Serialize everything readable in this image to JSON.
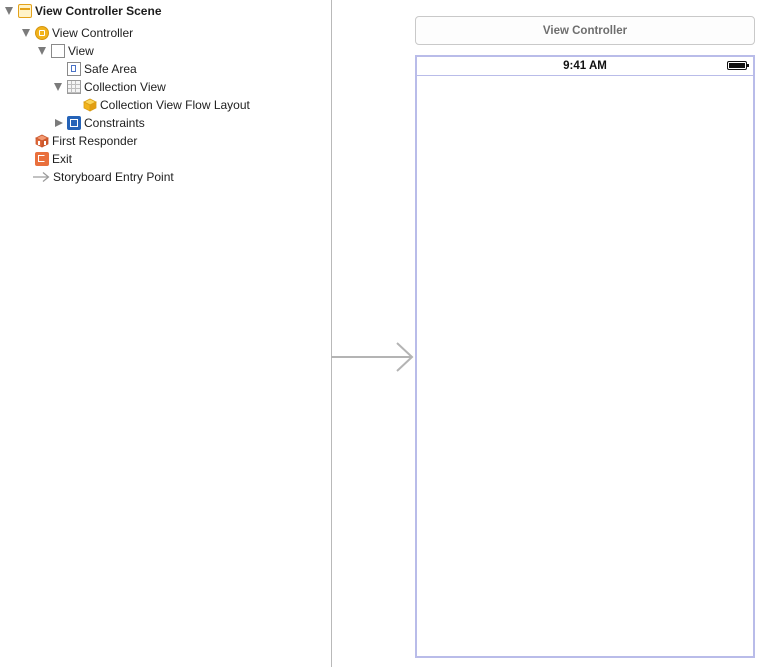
{
  "outline": {
    "scene": {
      "label": "View Controller Scene",
      "icon": "scene-icon"
    },
    "view_controller": {
      "label": "View Controller",
      "icon": "view-controller-icon"
    },
    "view": {
      "label": "View",
      "icon": "view-icon"
    },
    "safe_area": {
      "label": "Safe Area",
      "icon": "safe-area-icon"
    },
    "collection_view": {
      "label": "Collection View",
      "icon": "collection-view-icon"
    },
    "flow_layout": {
      "label": "Collection View Flow Layout",
      "icon": "cube-icon"
    },
    "constraints": {
      "label": "Constraints",
      "icon": "constraints-icon"
    },
    "first_responder": {
      "label": "First Responder",
      "icon": "first-responder-icon"
    },
    "exit": {
      "label": "Exit",
      "icon": "exit-icon"
    },
    "entry_point": {
      "label": "Storyboard Entry Point",
      "icon": "arrow-right-icon"
    }
  },
  "canvas": {
    "scene_title": "View Controller",
    "status_time": "9:41 AM",
    "battery_icon": "battery-icon"
  },
  "colors": {
    "scene_accent": "#e4a21a",
    "view_controller": "#f2b31b",
    "constraints": "#2563b8",
    "exit": "#e9703d",
    "first_responder": "#e16a3b",
    "device_border": "#b9bce9"
  }
}
